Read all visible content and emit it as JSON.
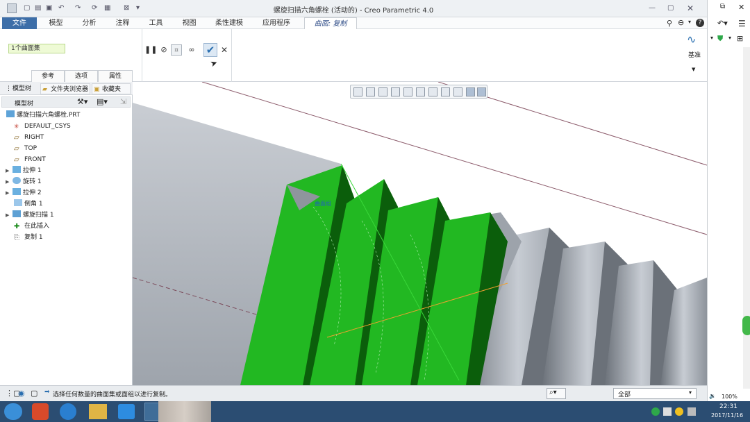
{
  "window": {
    "title": "螺旋扫描六角螺栓 (活动的) - Creo Parametric 4.0"
  },
  "tabs": [
    {
      "label": "文件"
    },
    {
      "label": "模型"
    },
    {
      "label": "分析"
    },
    {
      "label": "注释"
    },
    {
      "label": "工具"
    },
    {
      "label": "视图"
    },
    {
      "label": "柔性建模"
    },
    {
      "label": "应用程序"
    },
    {
      "label": "曲面: 复制"
    }
  ],
  "ribbon": {
    "selection_value": "1个曲面集",
    "panel_tabs": [
      "参考",
      "选项",
      "属性"
    ],
    "datum_label": "基准"
  },
  "left_panel": {
    "tabs": [
      "模型树",
      "文件夹浏览器",
      "收藏夹"
    ],
    "tree_header": "模型树",
    "tree_items": [
      {
        "label": "螺旋扫描六角螺栓.PRT"
      },
      {
        "label": "DEFAULT_CSYS"
      },
      {
        "label": "RIGHT"
      },
      {
        "label": "TOP"
      },
      {
        "label": "FRONT"
      },
      {
        "label": "拉伸 1"
      },
      {
        "label": "旋转 1"
      },
      {
        "label": "拉伸 2"
      },
      {
        "label": "倒角 1"
      },
      {
        "label": "螺旋扫描 1"
      },
      {
        "label": "在此插入"
      },
      {
        "label": "复制 1"
      }
    ]
  },
  "viewport": {
    "tag_label": "曲面组"
  },
  "status": {
    "message": "选择任何数量的曲面集或面组以进行复制。",
    "filter_value": "全部"
  },
  "taskbar": {
    "time": "22:31",
    "date": "2017/11/16"
  },
  "right_pane": {
    "zoom": "100%"
  },
  "colors": {
    "file_tab": "#3d6ea8",
    "highlight_green": "#22b822",
    "dark_green": "#0b5e0b",
    "selection_field": "#eefad5"
  }
}
